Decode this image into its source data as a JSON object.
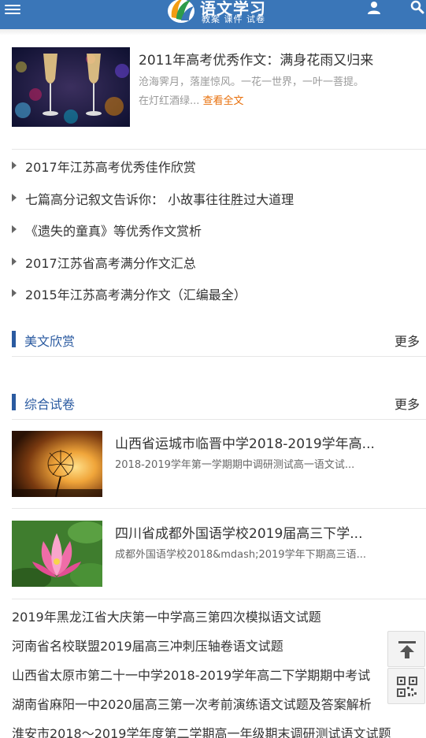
{
  "header": {
    "logo_title": "语文学习",
    "logo_subtitle": "教案 课件 试卷",
    "brand_color": "#3a76b8"
  },
  "featured": {
    "title": "2011年高考优秀作文：满身花雨又归来",
    "desc": "沧海霁月，落崖惊风。一花一世界，一叶一菩提。在灯红酒绿...",
    "more": "查看全文",
    "image_icon": "champagne-glasses-image"
  },
  "articles": [
    "2017年江苏高考优秀佳作欣赏",
    "七篇高分记叙文告诉你： 小故事往往胜过大道理",
    "《遗失的童真》等优秀作文赏析",
    "2017江苏省高考满分作文汇总",
    "2015年江苏高考满分作文（汇编最全）"
  ],
  "sections": {
    "meiwen": {
      "title": "美文欣赏",
      "more": "更多"
    },
    "shijuan": {
      "title": "综合试卷",
      "more": "更多"
    }
  },
  "exams": [
    {
      "title": "山西省运城市临晋中学2018-2019学年高...",
      "desc": "2018-2019学年第一学期期中调研测试高一语文试...",
      "image_icon": "dandelion-sunset-image"
    },
    {
      "title": "四川省成都外国语学校2019届高三下学...",
      "desc": "成都外国语学校2018&mdash;2019学年下期高三语...",
      "image_icon": "lotus-flower-image"
    }
  ],
  "plain_list": [
    "2019年黑龙江省大庆第一中学高三第四次模拟语文试题",
    "河南省名校联盟2019届高三冲刺压轴卷语文试题",
    "山西省太原市第二十一中学2018-2019学年高二下学期期中考试",
    "湖南省麻阳一中2020届高三第一次考前演练语文试题及答案解析",
    "淮安市2018～2019学年度第二学期高一年级期末调研测试语文试题"
  ],
  "floating": {
    "top_icon": "back-to-top-icon",
    "qr_icon": "qr-code-icon"
  }
}
